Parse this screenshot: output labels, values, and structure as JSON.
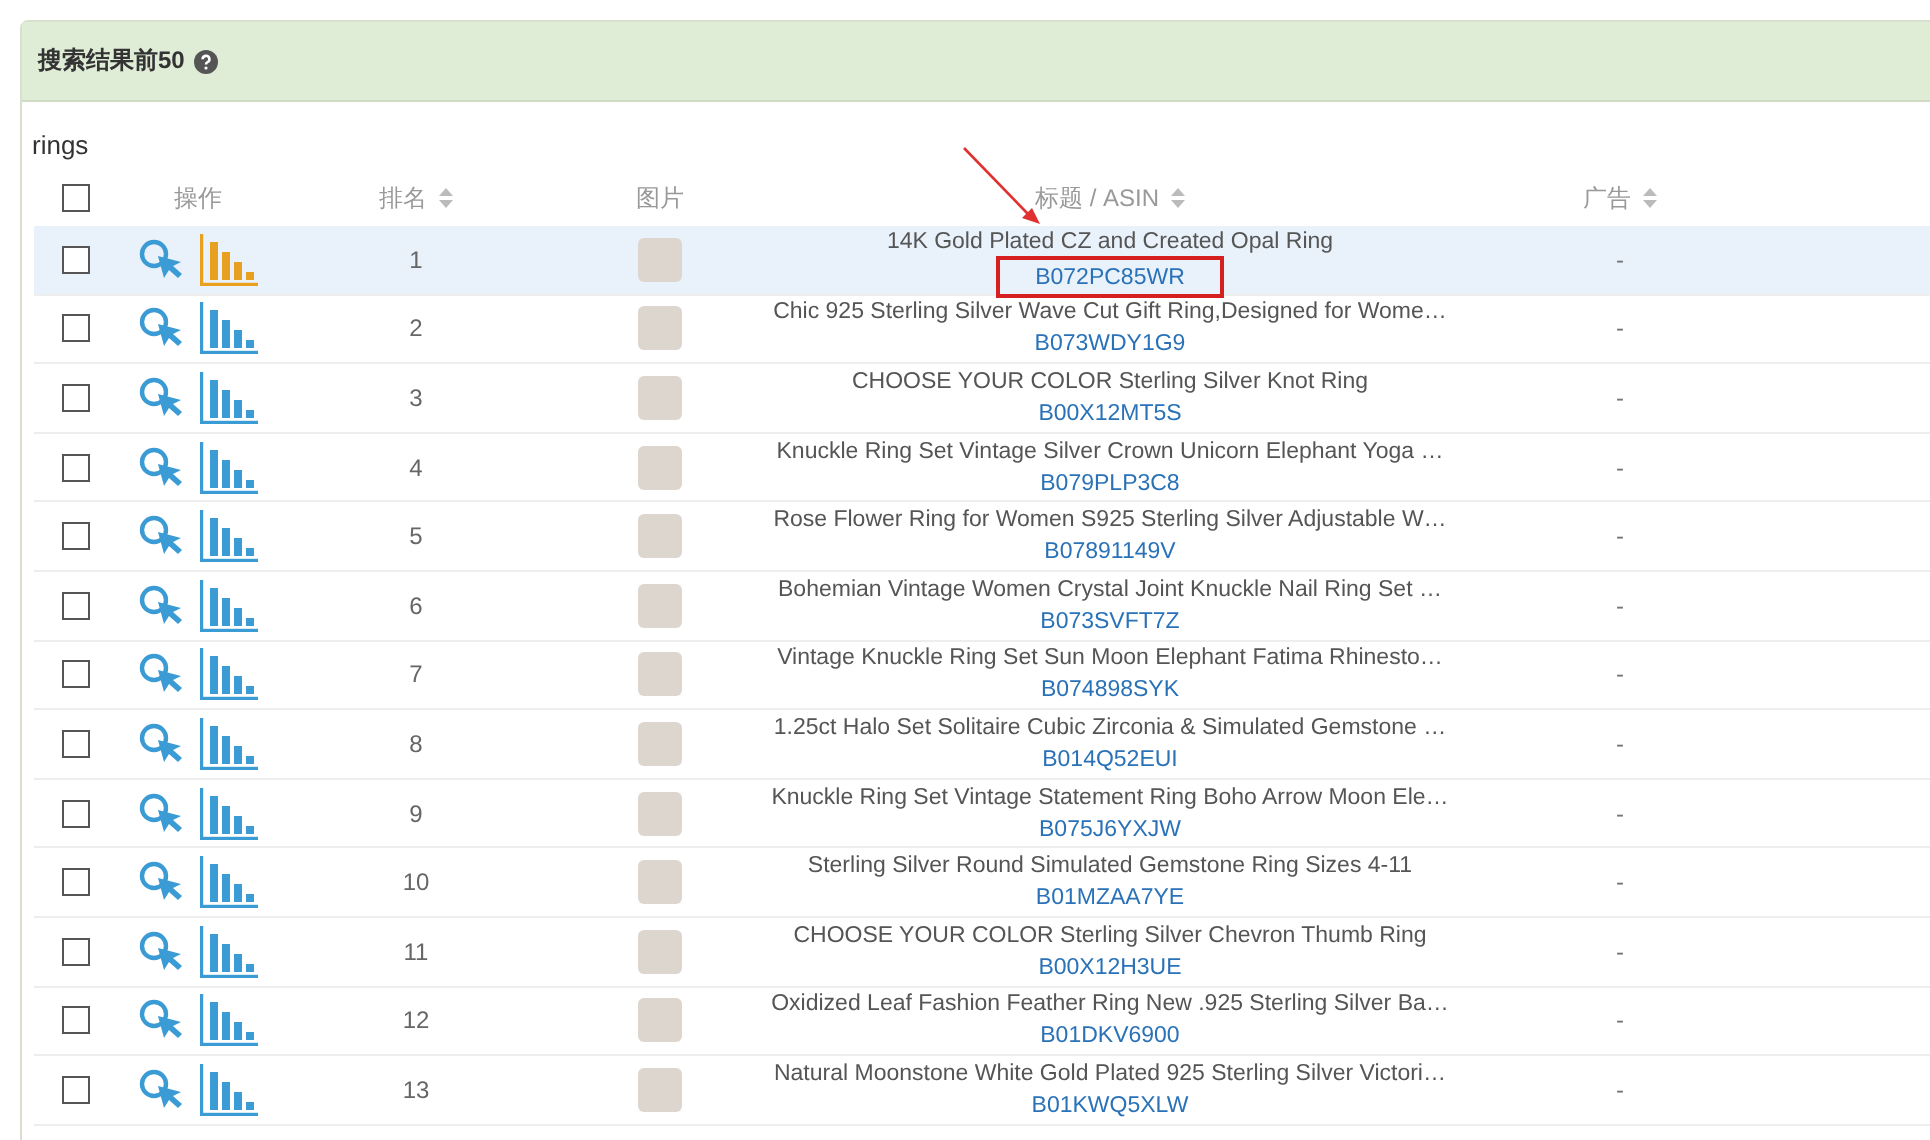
{
  "panel": {
    "title": "搜索结果前50",
    "keyword": "rings"
  },
  "table": {
    "select_all": {
      "checked": false
    },
    "columns": [
      {
        "label": "操作",
        "sortable": false
      },
      {
        "label": "排名",
        "sortable": true
      },
      {
        "label": "图片",
        "sortable": false
      },
      {
        "label": "标题 / ASIN",
        "sortable": true
      },
      {
        "label": "广告",
        "sortable": true
      }
    ],
    "rows": [
      {
        "selected": true,
        "checked": false,
        "rank": "1",
        "title": "14K Gold Plated CZ and Created Opal Ring",
        "asin": "B072PC85WR",
        "ad": "-"
      },
      {
        "selected": false,
        "checked": false,
        "rank": "2",
        "title": "Chic 925 Sterling Silver Wave Cut Gift Ring,Designed for Wome…",
        "asin": "B073WDY1G9",
        "ad": "-"
      },
      {
        "selected": false,
        "checked": false,
        "rank": "3",
        "title": "CHOOSE YOUR COLOR Sterling Silver Knot Ring",
        "asin": "B00X12MT5S",
        "ad": "-"
      },
      {
        "selected": false,
        "checked": false,
        "rank": "4",
        "title": "Knuckle Ring Set Vintage Silver Crown Unicorn Elephant Yoga …",
        "asin": "B079PLP3C8",
        "ad": "-"
      },
      {
        "selected": false,
        "checked": false,
        "rank": "5",
        "title": "Rose Flower Ring for Women S925 Sterling Silver Adjustable W…",
        "asin": "B07891149V",
        "ad": "-"
      },
      {
        "selected": false,
        "checked": false,
        "rank": "6",
        "title": "Bohemian Vintage Women Crystal Joint Knuckle Nail Ring Set …",
        "asin": "B073SVFT7Z",
        "ad": "-"
      },
      {
        "selected": false,
        "checked": false,
        "rank": "7",
        "title": "Vintage Knuckle Ring Set Sun Moon Elephant Fatima Rhinesto…",
        "asin": "B074898SYK",
        "ad": "-"
      },
      {
        "selected": false,
        "checked": false,
        "rank": "8",
        "title": "1.25ct Halo Set Solitaire Cubic Zirconia & Simulated Gemstone …",
        "asin": "B014Q52EUI",
        "ad": "-"
      },
      {
        "selected": false,
        "checked": false,
        "rank": "9",
        "title": "Knuckle Ring Set Vintage Statement Ring Boho Arrow Moon Ele…",
        "asin": "B075J6YXJW",
        "ad": "-"
      },
      {
        "selected": false,
        "checked": false,
        "rank": "10",
        "title": "Sterling Silver Round Simulated Gemstone Ring Sizes 4-11",
        "asin": "B01MZAA7YE",
        "ad": "-"
      },
      {
        "selected": false,
        "checked": false,
        "rank": "11",
        "title": "CHOOSE YOUR COLOR Sterling Silver Chevron Thumb Ring",
        "asin": "B00X12H3UE",
        "ad": "-"
      },
      {
        "selected": false,
        "checked": false,
        "rank": "12",
        "title": "Oxidized Leaf Fashion Feather Ring New .925 Sterling Silver Ba…",
        "asin": "B01DKV6900",
        "ad": "-"
      },
      {
        "selected": false,
        "checked": false,
        "rank": "13",
        "title": "Natural Moonstone White Gold Plated 925 Sterling Silver Victori…",
        "asin": "B01KWQ5XLW",
        "ad": "-"
      }
    ]
  }
}
